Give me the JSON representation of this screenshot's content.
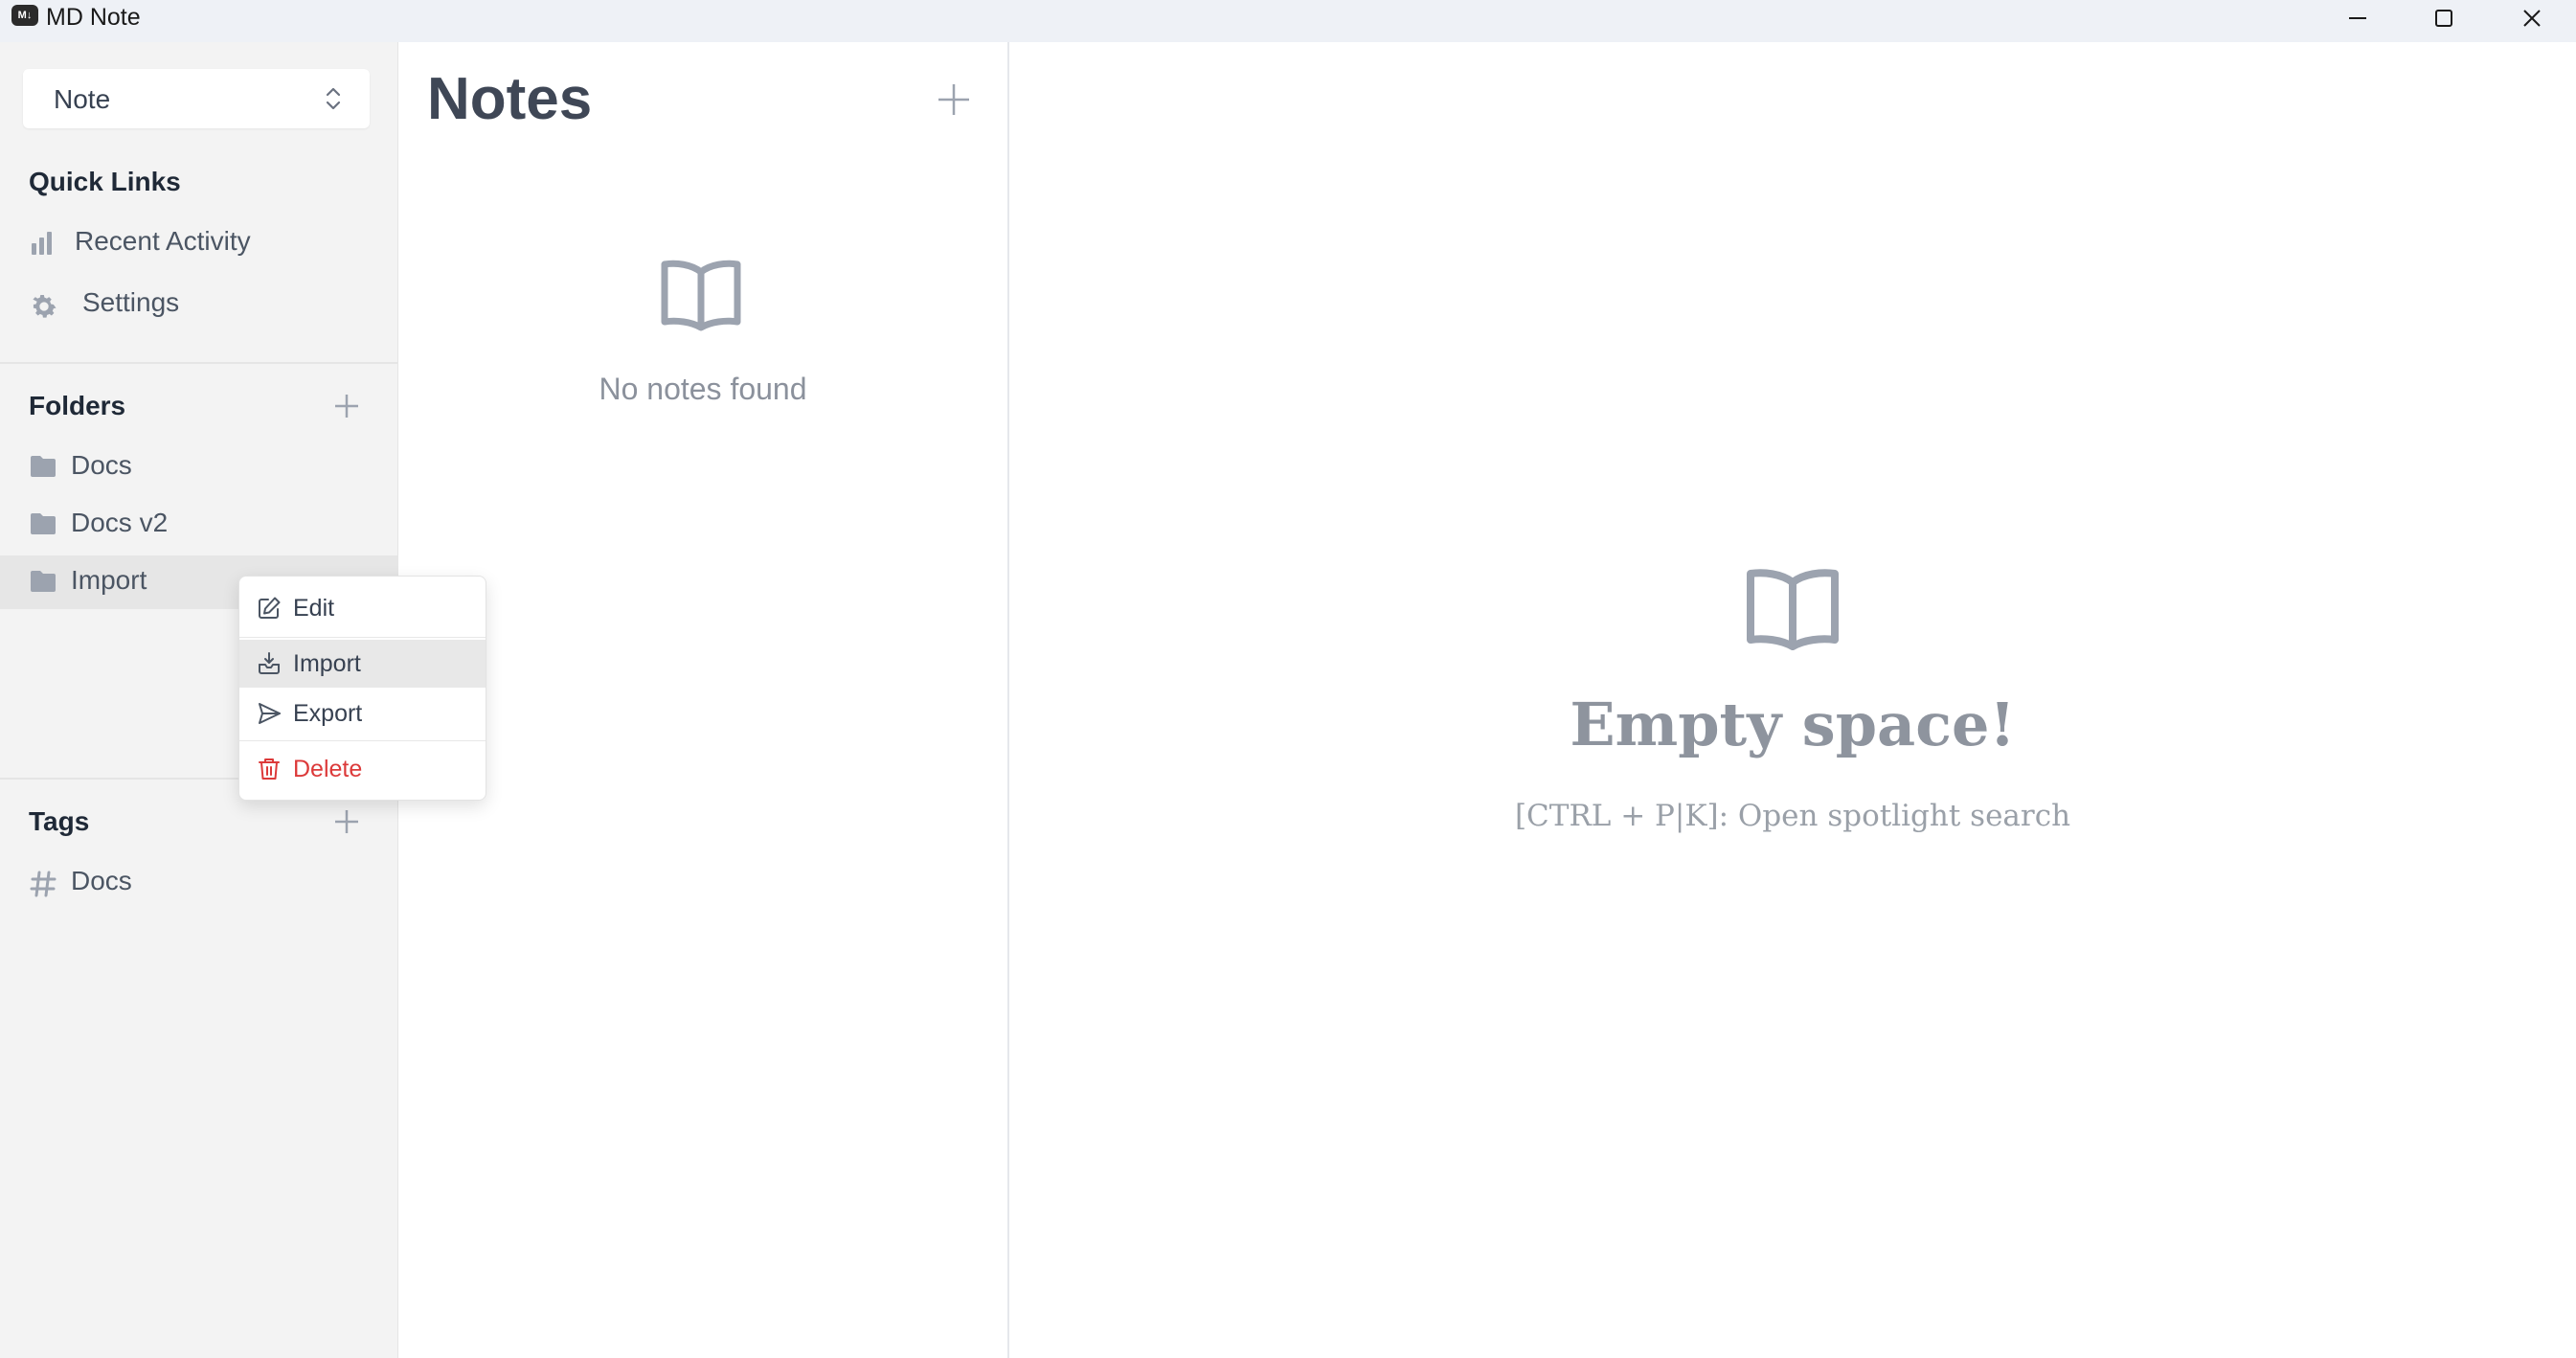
{
  "window": {
    "title": "MD Note",
    "logo_text": "M↓"
  },
  "sidebar": {
    "type_select": {
      "value": "Note"
    },
    "quick_links": {
      "title": "Quick Links",
      "items": [
        {
          "label": "Recent Activity",
          "icon": "bar-chart-icon"
        },
        {
          "label": "Settings",
          "icon": "gear-icon"
        }
      ]
    },
    "folders": {
      "title": "Folders",
      "items": [
        {
          "label": "Docs",
          "icon": "folder-icon"
        },
        {
          "label": "Docs v2",
          "icon": "folder-icon"
        },
        {
          "label": "Import",
          "icon": "folder-icon",
          "active": true
        }
      ]
    },
    "tags": {
      "title": "Tags",
      "items": [
        {
          "label": "Docs",
          "icon": "hash-icon"
        }
      ]
    }
  },
  "notes": {
    "title": "Notes",
    "empty_text": "No notes found"
  },
  "main": {
    "empty_title": "Empty space!",
    "empty_hint": "[CTRL + P|K]: Open spotlight search"
  },
  "context_menu": {
    "items": [
      {
        "label": "Edit",
        "icon": "pencil-square-icon"
      },
      {
        "label": "Import",
        "icon": "inbox-arrow-icon",
        "hovered": true
      },
      {
        "label": "Export",
        "icon": "paper-plane-icon"
      },
      {
        "label": "Delete",
        "icon": "trash-icon",
        "danger": true
      }
    ]
  },
  "colors": {
    "sidebar_bg": "#f3f3f3",
    "titlebar_bg": "#eef1f6",
    "danger": "#dc3a3a",
    "muted_text": "#8e949e"
  }
}
